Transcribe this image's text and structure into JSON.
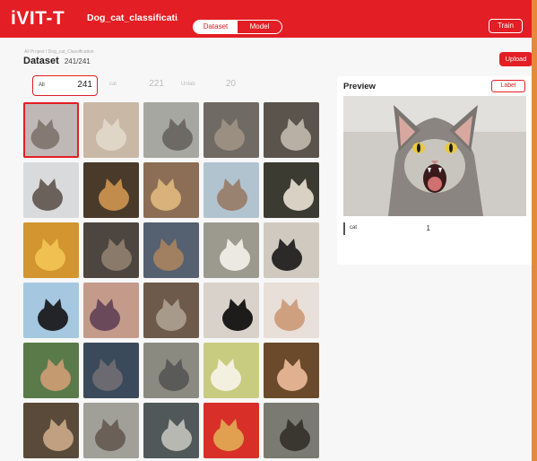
{
  "header": {
    "logo": "iVIT-T",
    "project": "Dog_cat_classificati...",
    "tabs": [
      "Dataset",
      "Model"
    ],
    "train_label": "Train",
    "accent": "#e31e24"
  },
  "page": {
    "breadcrumb": "All Project / Dog_cat_Classification",
    "title": "Dataset",
    "count": "241/241",
    "upload_label": "Upload"
  },
  "filters": [
    {
      "label": "All",
      "count": "241"
    },
    {
      "label": "cat",
      "count": "221"
    },
    {
      "label": "Unlab",
      "count": "20"
    }
  ],
  "gallery": {
    "thumbnails": [
      {
        "name": "cat-01",
        "bg": "#bfb8b6",
        "fg": "#857a73"
      },
      {
        "name": "cat-02",
        "bg": "#c9b8a5",
        "fg": "#e0d6c8"
      },
      {
        "name": "cat-03",
        "bg": "#a7a7a2",
        "fg": "#6d6a66"
      },
      {
        "name": "cat-04",
        "bg": "#6f6a64",
        "fg": "#9a8f80"
      },
      {
        "name": "cat-05",
        "bg": "#5a544d",
        "fg": "#b8b0a4"
      },
      {
        "name": "cat-06",
        "bg": "#d9dadb",
        "fg": "#6a625a"
      },
      {
        "name": "cat-07",
        "bg": "#4a3a2a",
        "fg": "#c28c4c"
      },
      {
        "name": "cat-08",
        "bg": "#8b6e55",
        "fg": "#d8b27a"
      },
      {
        "name": "cat-09",
        "bg": "#b2c3d0",
        "fg": "#9a8270"
      },
      {
        "name": "cat-10",
        "bg": "#3b3b32",
        "fg": "#d9d2c4"
      },
      {
        "name": "cat-11",
        "bg": "#d2952f",
        "fg": "#f0c050"
      },
      {
        "name": "cat-12",
        "bg": "#4c4540",
        "fg": "#8a7a6a"
      },
      {
        "name": "cat-13",
        "bg": "#556070",
        "fg": "#a08060"
      },
      {
        "name": "cat-14",
        "bg": "#9c9a8e",
        "fg": "#ece9e2"
      },
      {
        "name": "cat-15",
        "bg": "#cfc9c0",
        "fg": "#2c2a28"
      },
      {
        "name": "cat-16",
        "bg": "#a5c8e0",
        "fg": "#222428"
      },
      {
        "name": "cat-17",
        "bg": "#c49a8a",
        "fg": "#6a4a5a"
      },
      {
        "name": "cat-18",
        "bg": "#6e5a4a",
        "fg": "#a89a8a"
      },
      {
        "name": "cat-19",
        "bg": "#d8d2ca",
        "fg": "#1e1c1a"
      },
      {
        "name": "cat-20",
        "bg": "#e8dfd8",
        "fg": "#cfa080"
      },
      {
        "name": "cat-21",
        "bg": "#5a7a4a",
        "fg": "#c49a70"
      },
      {
        "name": "cat-22",
        "bg": "#3a4a5a",
        "fg": "#6a6a70"
      },
      {
        "name": "cat-23",
        "bg": "#8a8a80",
        "fg": "#5a5a58"
      },
      {
        "name": "cat-24",
        "bg": "#c8cc80",
        "fg": "#f4f0e0"
      },
      {
        "name": "cat-25",
        "bg": "#6a4a2a",
        "fg": "#e0b090"
      },
      {
        "name": "cat-26",
        "bg": "#5a4a3a",
        "fg": "#c0a080"
      },
      {
        "name": "cat-27",
        "bg": "#a0a098",
        "fg": "#6a6058"
      },
      {
        "name": "cat-28",
        "bg": "#50585a",
        "fg": "#b8b8b2"
      },
      {
        "name": "cat-29",
        "bg": "#d83028",
        "fg": "#e0a050"
      },
      {
        "name": "cat-30",
        "bg": "#7a7a72",
        "fg": "#3a3630"
      }
    ]
  },
  "preview": {
    "title": "Preview",
    "label_button": "Label",
    "labels": [
      {
        "name": "cat",
        "count": "1"
      }
    ]
  }
}
